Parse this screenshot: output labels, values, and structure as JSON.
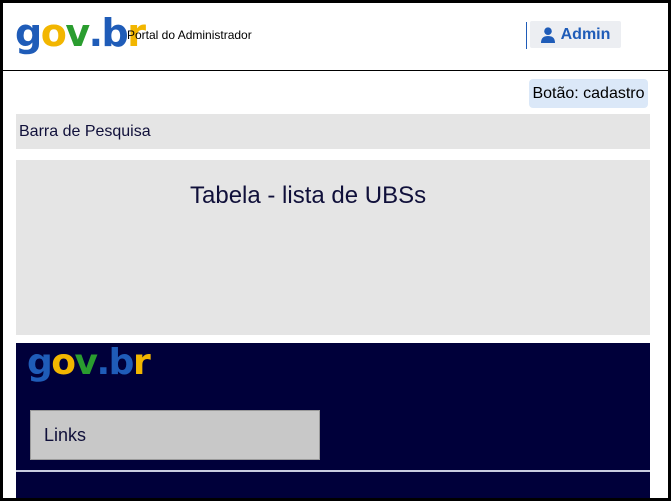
{
  "header": {
    "logo": {
      "g": "g",
      "o": "o",
      "v": "v",
      "dot": ".",
      "b": "b",
      "r": "r"
    },
    "portal_title": "Portal do Administrador",
    "admin_label": "Admin",
    "user_icon": "user-icon"
  },
  "actions": {
    "cadastro_label": "Botão: cadastro"
  },
  "search": {
    "label": "Barra de Pesquisa"
  },
  "table": {
    "title": "Tabela - lista de UBSs"
  },
  "footer": {
    "logo": {
      "g": "g",
      "o": "o",
      "v": "v",
      "dot": ".",
      "b": "b",
      "r": "r"
    },
    "links_label": "Links"
  },
  "colors": {
    "brand_blue": "#1f5cb8",
    "brand_yellow": "#f2b600",
    "brand_green": "#2a9d2f",
    "footer_bg": "#00003a",
    "placeholder_gray": "#e5e5e5"
  }
}
